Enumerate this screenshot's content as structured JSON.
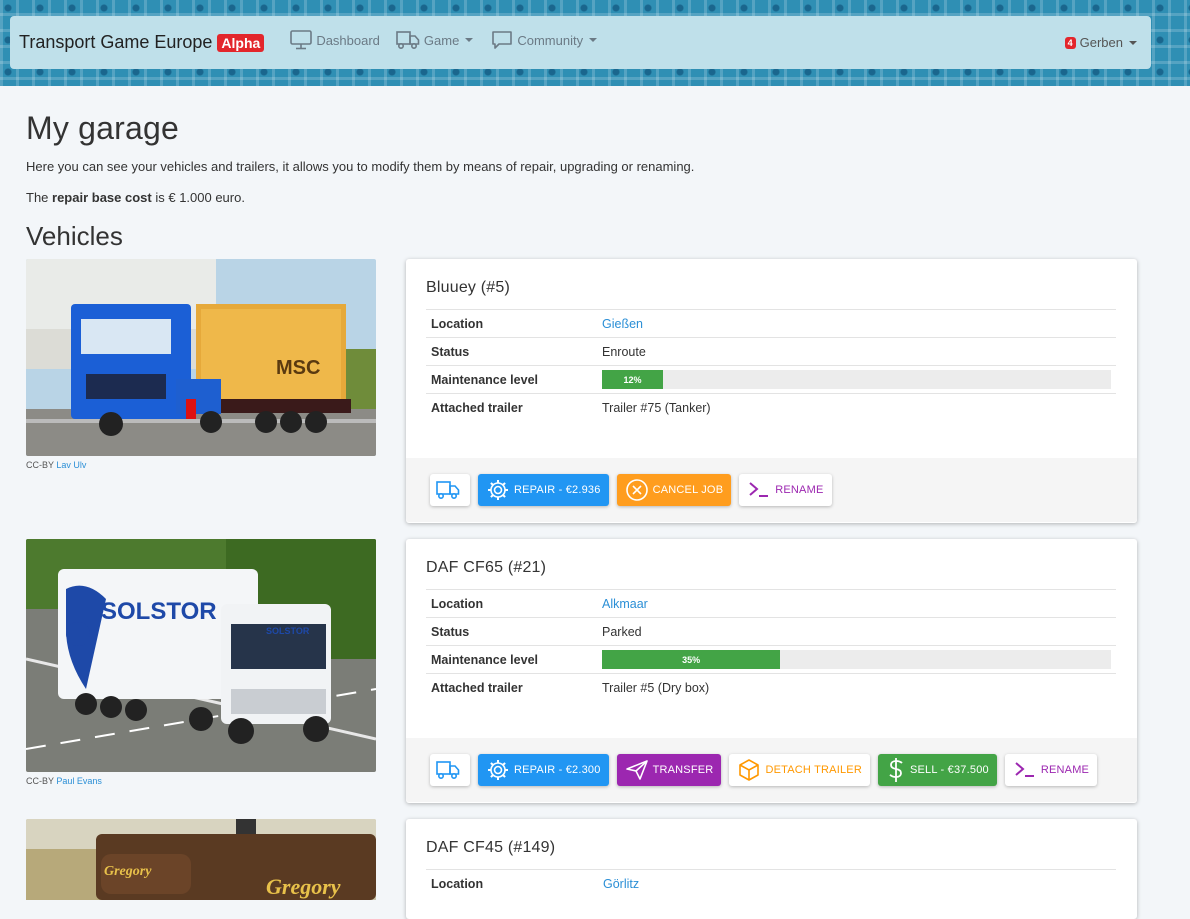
{
  "app": {
    "brand": "Transport Game Europe",
    "badge": "Alpha"
  },
  "nav": {
    "dashboard": "Dashboard",
    "game": "Game",
    "community": "Community",
    "notifications": "4",
    "user": "Gerben"
  },
  "page": {
    "title": "My garage",
    "description": "Here you can see your vehicles and trailers, it allows you to modify them by means of repair, upgrading or renaming.",
    "repair_prefix": "The ",
    "repair_bold": "repair base cost",
    "repair_suffix": " is € 1.000 euro.",
    "vehicles_heading": "Vehicles"
  },
  "labels": {
    "location": "Location",
    "status": "Status",
    "maintenance": "Maintenance level",
    "attached_trailer": "Attached trailer",
    "credit_prefix": "CC-BY"
  },
  "vehicles": [
    {
      "name": "Bluuey (#5)",
      "location": "Gießen",
      "status": "Enroute",
      "maintenance": 0.12,
      "maintenance_label": "12%",
      "trailer": "Trailer #75 (Tanker)",
      "credit": "Lav Ulv",
      "buttons": {
        "repair": "REPAIR - €2.936",
        "cancel": "CANCEL JOB",
        "rename": "RENAME"
      }
    },
    {
      "name": "DAF CF65 (#21)",
      "location": "Alkmaar",
      "status": "Parked",
      "maintenance": 0.35,
      "maintenance_label": "35%",
      "trailer": "Trailer #5 (Dry box)",
      "credit": "Paul Evans",
      "buttons": {
        "repair": "REPAIR - €2.300",
        "transfer": "TRANSFER",
        "detach": "DETACH TRAILER",
        "sell": "SELL - €37.500",
        "rename": "RENAME"
      }
    },
    {
      "name": "DAF CF45 (#149)",
      "location": "Görlitz"
    }
  ],
  "colors": {
    "primary": "#2196f3",
    "warning": "#ff9d1e",
    "success": "#43a446",
    "purple": "#9c27b0",
    "link": "#2b8fd6",
    "alpha": "#e3262c"
  },
  "icons": [
    "monitor-icon",
    "truck-icon",
    "chat-icon",
    "gear-icon",
    "cancel-circle-icon",
    "terminal-icon",
    "send-icon",
    "box-icon",
    "dollar-icon"
  ]
}
